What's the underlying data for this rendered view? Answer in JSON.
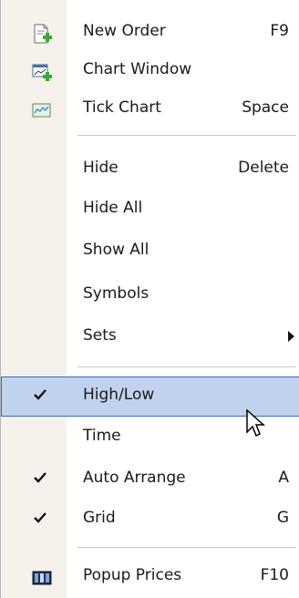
{
  "menu": {
    "items": [
      {
        "label": "New Order",
        "shortcut": "F9",
        "icon": "new-order-icon"
      },
      {
        "label": "Chart Window",
        "shortcut": "",
        "icon": "chart-window-icon"
      },
      {
        "label": "Tick Chart",
        "shortcut": "Space",
        "icon": "tick-chart-icon"
      },
      {
        "label": "Hide",
        "shortcut": "Delete"
      },
      {
        "label": "Hide All",
        "shortcut": ""
      },
      {
        "label": "Show All",
        "shortcut": ""
      },
      {
        "label": "Symbols",
        "shortcut": ""
      },
      {
        "label": "Sets",
        "shortcut": "",
        "submenu": true
      },
      {
        "label": "High/Low",
        "shortcut": "",
        "checked": true,
        "highlighted": true
      },
      {
        "label": "Time",
        "shortcut": ""
      },
      {
        "label": "Auto Arrange",
        "shortcut": "A",
        "checked": true
      },
      {
        "label": "Grid",
        "shortcut": "G",
        "checked": true
      },
      {
        "label": "Popup Prices",
        "shortcut": "F10",
        "icon": "popup-prices-icon"
      }
    ]
  },
  "colors": {
    "highlight_bg": "#c1d2ee",
    "highlight_border": "#316ac5",
    "gutter_bg": "#f4f2ea"
  }
}
